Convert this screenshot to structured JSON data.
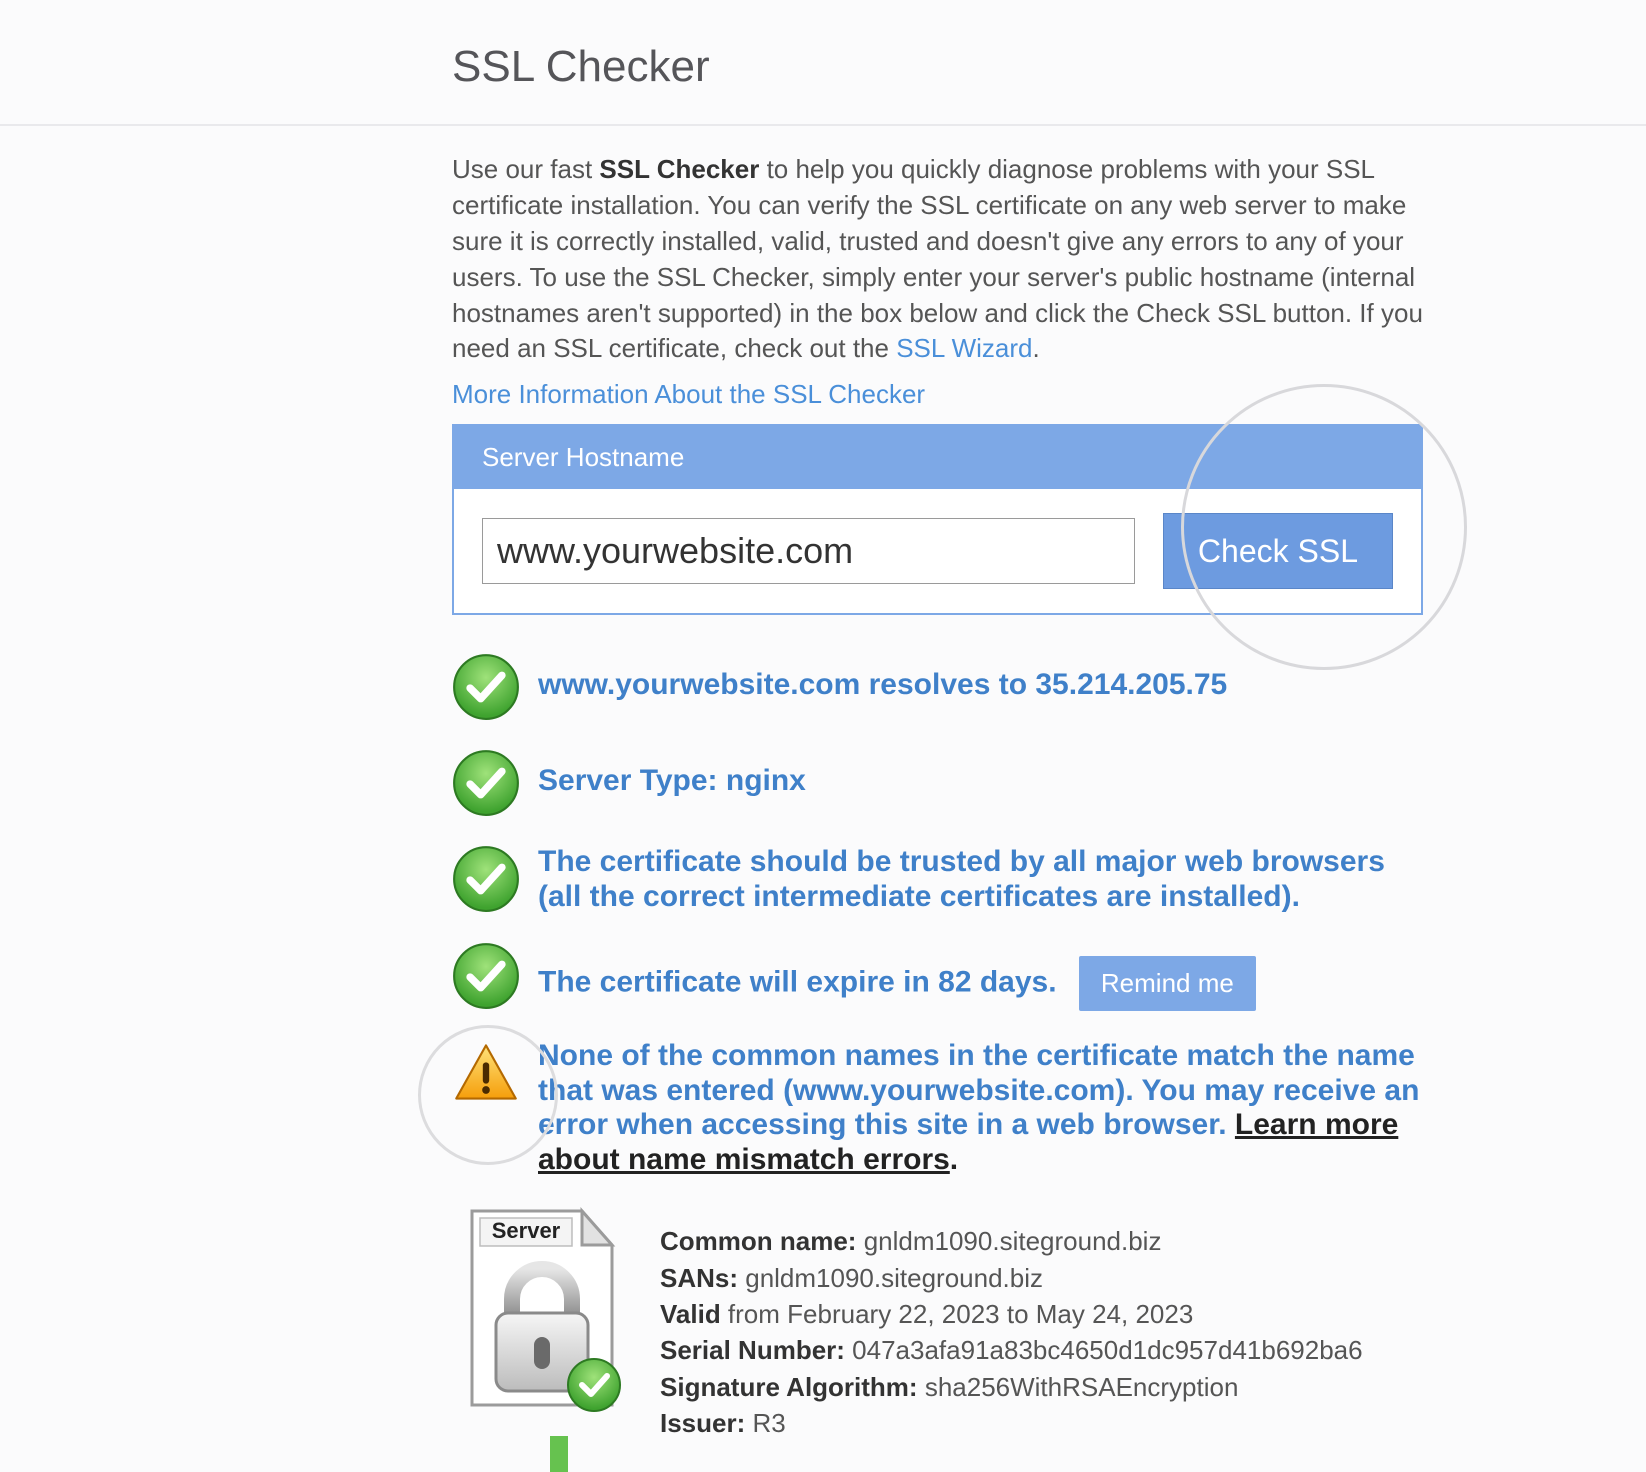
{
  "page": {
    "title": "SSL Checker"
  },
  "intro": {
    "prefix": "Use our fast ",
    "strong": "SSL Checker",
    "body": " to help you quickly diagnose problems with your SSL certificate installation. You can verify the SSL certificate on any web server to make sure it is correctly installed, valid, trusted and doesn't give any errors to any of your users. To use the SSL Checker, simply enter your server's public hostname (internal hostnames aren't supported) in the box below and click the Check SSL button. If you need an SSL certificate, check out the ",
    "link_text": "SSL Wizard",
    "suffix": "."
  },
  "more_info_link": "More Information About the SSL Checker",
  "form": {
    "header": "Server Hostname",
    "hostname_value": "www.yourwebsite.com",
    "check_button": "Check SSL"
  },
  "results": {
    "resolve": "www.yourwebsite.com resolves to 35.214.205.75",
    "server_type": "Server Type: nginx",
    "trusted": "The certificate should be trusted by all major web browsers (all the correct intermediate certificates are installed).",
    "expire": "The certificate will expire in 82 days.",
    "remind_button": "Remind me",
    "mismatch_prefix": "None of the common names in the certificate match the name that was entered (www.yourwebsite.com). You may receive an error when accessing this site in a web browser. ",
    "mismatch_link": "Learn more about name mismatch errors",
    "mismatch_suffix": "."
  },
  "cert": {
    "server_label": "Server",
    "fields": {
      "common_name_label": "Common name:",
      "common_name": " gnldm1090.siteground.biz",
      "sans_label": "SANs:",
      "sans": " gnldm1090.siteground.biz",
      "valid_label": "Valid",
      "valid": " from February 22, 2023 to May 24, 2023",
      "serial_label": "Serial Number:",
      "serial": " 047a3afa91a83bc4650d1dc957d41b692ba6",
      "sigalg_label": "Signature Algorithm:",
      "sigalg": " sha256WithRSAEncryption",
      "issuer_label": "Issuer:",
      "issuer": " R3"
    }
  }
}
